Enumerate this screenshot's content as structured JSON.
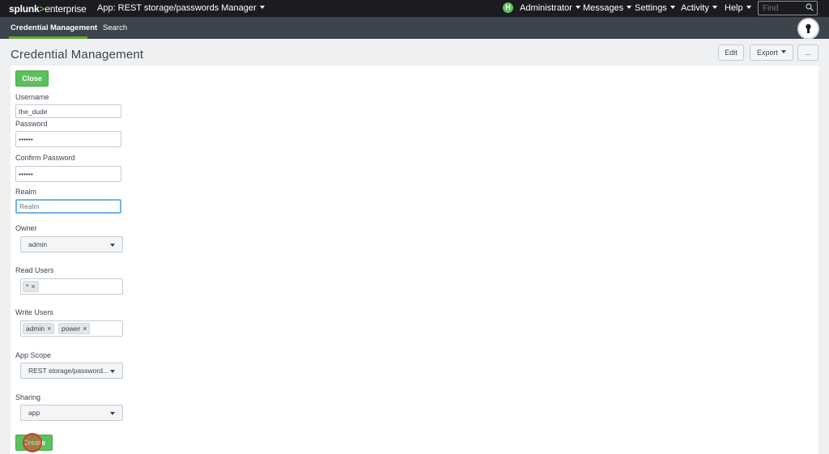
{
  "topbar": {
    "logo_main": "splunk",
    "logo_gt": ">",
    "logo_sub": "enterprise",
    "app_label": "App: REST storage/passwords Manager",
    "status_badge": "H",
    "nav": [
      "Administrator",
      "Messages",
      "Settings",
      "Activity",
      "Help"
    ],
    "find_placeholder": "Find"
  },
  "appbar": {
    "tabs": [
      "Credential Management",
      "Search"
    ]
  },
  "header": {
    "title": "Credential Management",
    "edit_label": "Edit",
    "export_label": "Export",
    "more_label": "..."
  },
  "form": {
    "close_label": "Close",
    "username_label": "Username",
    "username_value": "the_dude",
    "password_label": "Password",
    "password_value": "••••••",
    "confirm_label": "Confirm Password",
    "confirm_value": "••••••",
    "realm_label": "Realm",
    "realm_placeholder": "Realm",
    "owner_label": "Owner",
    "owner_value": "admin",
    "read_label": "Read Users",
    "read_users": [
      "*"
    ],
    "write_label": "Write Users",
    "write_users": [
      "admin",
      "power"
    ],
    "scope_label": "App Scope",
    "scope_value": "REST storage/password...",
    "sharing_label": "Sharing",
    "sharing_value": "app",
    "create_label": "Create",
    "pill_remove": "×"
  },
  "colors": {
    "topbar_bg": "#1a1c20",
    "appbar_bg": "#3c444d",
    "accent_green": "#5cc05c",
    "focus_blue": "#71b3e8"
  }
}
